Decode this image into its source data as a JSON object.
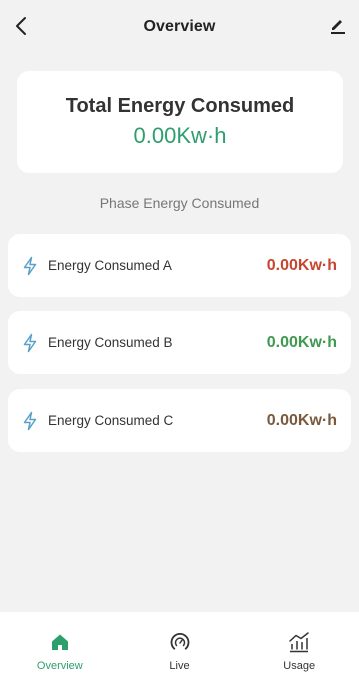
{
  "header": {
    "title": "Overview",
    "back_icon": "chevron-left-icon",
    "edit_icon": "pencil-icon"
  },
  "total": {
    "title": "Total Energy Consumed",
    "value": "0.00Kw·h"
  },
  "section_label": "Phase Energy Consumed",
  "phases": [
    {
      "label": "Energy Consumed A",
      "value": "0.00Kw·h",
      "color": "#c9452f",
      "icon": "lightning-icon"
    },
    {
      "label": "Energy Consumed B",
      "value": "0.00Kw·h",
      "color": "#3f9a4f",
      "icon": "lightning-icon"
    },
    {
      "label": "Energy Consumed C",
      "value": "0.00Kw·h",
      "color": "#7a5a3e",
      "icon": "lightning-icon"
    }
  ],
  "tabs": [
    {
      "label": "Overview",
      "icon": "home-icon",
      "active": true
    },
    {
      "label": "Live",
      "icon": "gauge-icon",
      "active": false
    },
    {
      "label": "Usage",
      "icon": "chart-icon",
      "active": false
    }
  ],
  "colors": {
    "accent": "#2e9e6e",
    "background": "#f2f2f2",
    "card": "#ffffff",
    "bolt_icon": "#5aa0c8"
  }
}
